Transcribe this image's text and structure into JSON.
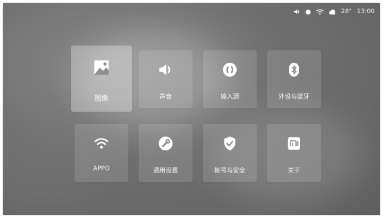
{
  "status": {
    "temperature": "28°",
    "time": "13:00",
    "icons": [
      "volume-icon",
      "dot-icon",
      "wifi-icon",
      "weather-icon"
    ]
  },
  "tiles": [
    {
      "label": "图像",
      "icon": "image-icon",
      "selected": true
    },
    {
      "label": "声音",
      "icon": "speaker-icon"
    },
    {
      "label": "输入源",
      "icon": "input-source-icon"
    },
    {
      "label": "外设与蓝牙",
      "icon": "bluetooth-icon"
    },
    {
      "label": "APPO",
      "icon": "wifi-icon"
    },
    {
      "label": "通用设置",
      "icon": "wrench-icon"
    },
    {
      "label": "帐号与安全",
      "icon": "shield-check-icon"
    },
    {
      "label": "关于",
      "icon": "mi-logo-icon"
    }
  ],
  "colors": {
    "icon": "#ffffff",
    "tile_bg": "rgba(255,255,255,0.12)",
    "selected_bg": "rgba(255,255,255,0.30)"
  }
}
